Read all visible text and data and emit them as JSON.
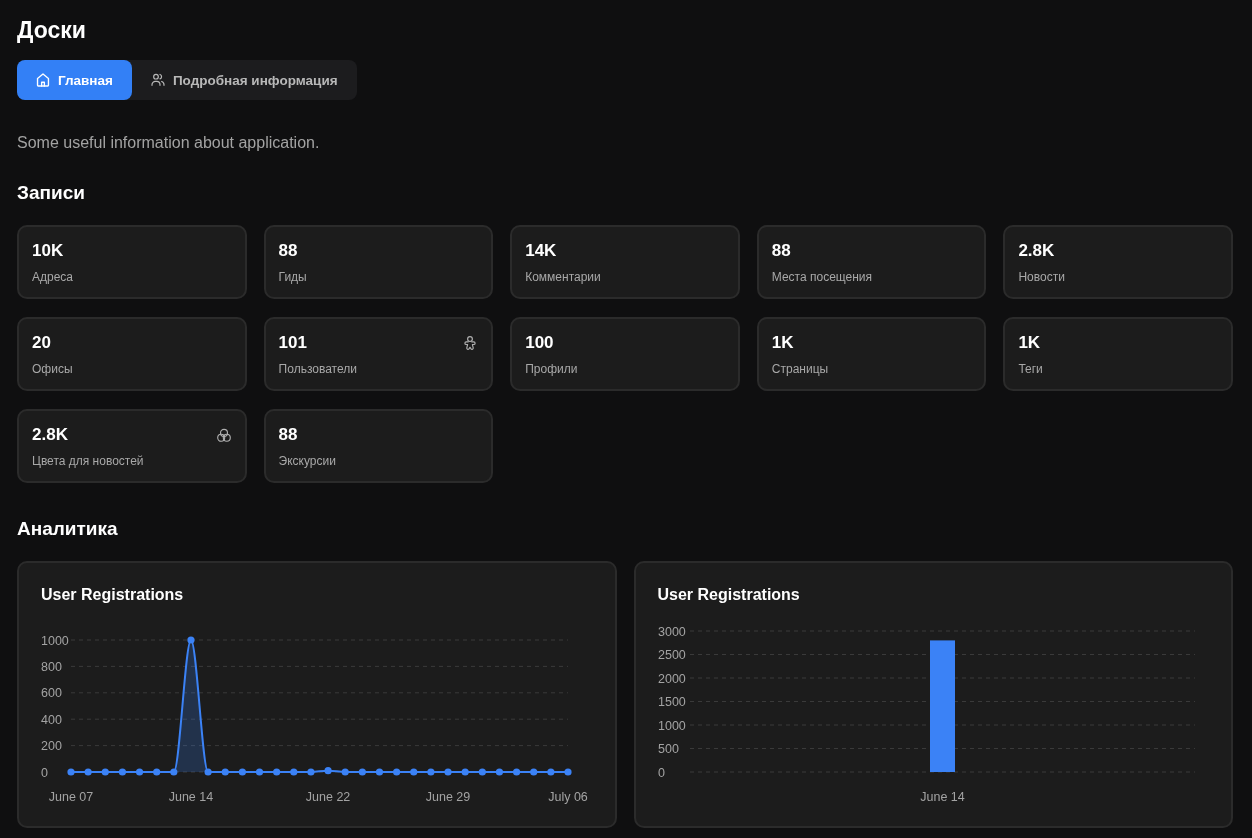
{
  "page_title": "Доски",
  "tabs": [
    {
      "label": "Главная",
      "selected": true
    },
    {
      "label": "Подробная информация",
      "selected": false
    }
  ],
  "description": "Some useful information about application.",
  "records": {
    "heading": "Записи",
    "cards": [
      {
        "value": "10K",
        "label": "Адреса",
        "kind": "plain"
      },
      {
        "value": "88",
        "label": "Гиды",
        "kind": "plain"
      },
      {
        "value": "14K",
        "label": "Комментарии",
        "kind": "plain"
      },
      {
        "value": "88",
        "label": "Места посещения",
        "kind": "plain"
      },
      {
        "value": "2.8K",
        "label": "Новости",
        "kind": "plain"
      },
      {
        "value": "20",
        "label": "Офисы",
        "kind": "plain"
      },
      {
        "value": "101",
        "label": "Пользователи",
        "kind": "figure"
      },
      {
        "value": "100",
        "label": "Профили",
        "kind": "plain"
      },
      {
        "value": "1K",
        "label": "Страницы",
        "kind": "plain"
      },
      {
        "value": "1K",
        "label": "Теги",
        "kind": "plain"
      },
      {
        "value": "2.8K",
        "label": "Цвета для новостей",
        "kind": "circles"
      },
      {
        "value": "88",
        "label": "Экскурсии",
        "kind": "plain"
      }
    ]
  },
  "analytics": {
    "heading": "Аналитика",
    "charts": [
      {
        "chart_data": {
          "type": "area",
          "title": "User Registrations",
          "categories": [
            "June 07",
            null,
            null,
            null,
            null,
            null,
            null,
            "June 14",
            null,
            null,
            null,
            null,
            null,
            null,
            null,
            "June 22",
            null,
            null,
            null,
            null,
            null,
            null,
            "June 29",
            null,
            null,
            null,
            null,
            null,
            null,
            "July 06"
          ],
          "series": [
            {
              "color": "#3b82f6",
              "values": [
                0,
                0,
                0,
                0,
                0,
                0,
                0,
                1000,
                0,
                0,
                0,
                0,
                0,
                0,
                0,
                10,
                0,
                0,
                0,
                0,
                0,
                0,
                0,
                0,
                0,
                0,
                0,
                0,
                0,
                0
              ]
            }
          ],
          "ylim": [
            0,
            1000
          ],
          "yticks": [
            0,
            200,
            400,
            600,
            800,
            1000
          ],
          "grid": true
        }
      },
      {
        "chart_data": {
          "type": "bar",
          "title": "User Registrations",
          "categories": [
            "June 14"
          ],
          "series": [
            {
              "color": "#3b82f6",
              "values": [
                2800
              ]
            }
          ],
          "ylim": [
            0,
            3000
          ],
          "yticks": [
            0,
            500,
            1000,
            1500,
            2000,
            2500,
            3000
          ],
          "grid": true
        }
      }
    ]
  }
}
